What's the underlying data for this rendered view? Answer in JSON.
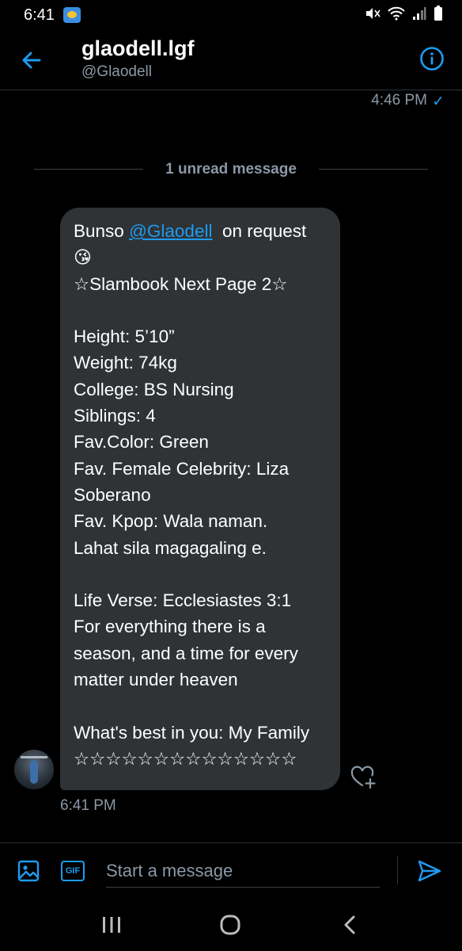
{
  "status_bar": {
    "time": "6:41"
  },
  "header": {
    "name": "glaodell.lgf",
    "handle": "@Glaodell"
  },
  "previous_message": {
    "time": "4:46 PM",
    "read_check": "✓"
  },
  "unread_divider": {
    "label": "1 unread message"
  },
  "message": {
    "greeting_prefix": "Bunso ",
    "mention": "@Glaodell",
    "greeting_suffix": "  on request",
    "emoji": "😘",
    "lines": [
      "☆Slambook Next Page 2☆",
      "",
      "Height: 5’10”",
      "Weight: 74kg",
      "College: BS Nursing",
      "Siblings: 4",
      "Fav.Color: Green",
      "Fav. Female Celebrity: Liza",
      "Soberano",
      "Fav. Kpop: Wala naman.",
      "Lahat sila magagaling e.",
      "",
      "Life Verse: Ecclesiastes 3:1",
      "For everything there is a",
      "season, and a time for every",
      "matter under heaven",
      "",
      "What's best in you: My Family",
      "☆☆☆☆☆☆☆☆☆☆☆☆☆☆"
    ],
    "time": "6:41 PM"
  },
  "composer": {
    "placeholder": "Start a message",
    "gif_label": "GIF"
  },
  "colors": {
    "accent": "#1d9bf0",
    "bubble": "#2f3336",
    "muted": "#8b98a5",
    "background": "#000000"
  }
}
